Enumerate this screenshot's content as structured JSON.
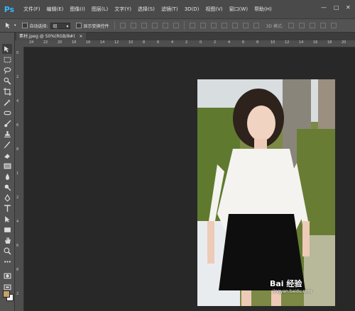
{
  "app": {
    "logo": "Ps"
  },
  "menu": [
    "文件(F)",
    "编辑(E)",
    "图像(I)",
    "图层(L)",
    "文字(Y)",
    "选择(S)",
    "滤镜(T)",
    "3D(D)",
    "视图(V)",
    "窗口(W)",
    "帮助(H)"
  ],
  "window_controls": {
    "minimize": "—",
    "maximize": "□",
    "close": "✕"
  },
  "options": {
    "auto_select_label": "自动选择:",
    "auto_select_value": "组",
    "show_transform_label": "显示变换控件",
    "mode_3d_label": "3D 模式:"
  },
  "document": {
    "tab_title": "素材.jpeg @ 50%(RGB/8#)",
    "close": "×"
  },
  "ruler_h_labels": [
    "24",
    "22",
    "20",
    "18",
    "16",
    "14",
    "12",
    "10",
    "8",
    "6",
    "4",
    "2",
    "0",
    "2",
    "4",
    "6",
    "8",
    "10",
    "12",
    "14",
    "16",
    "18",
    "20"
  ],
  "ruler_v_labels": [
    "0",
    "2",
    "4",
    "6",
    "8",
    "1",
    "2",
    "4",
    "6",
    "8",
    "2"
  ],
  "watermark": {
    "brand": "Bai 经验",
    "url": "jingyan.baidu.com"
  },
  "colors": {
    "foreground": "#c4a06b",
    "background": "#ffffff"
  }
}
